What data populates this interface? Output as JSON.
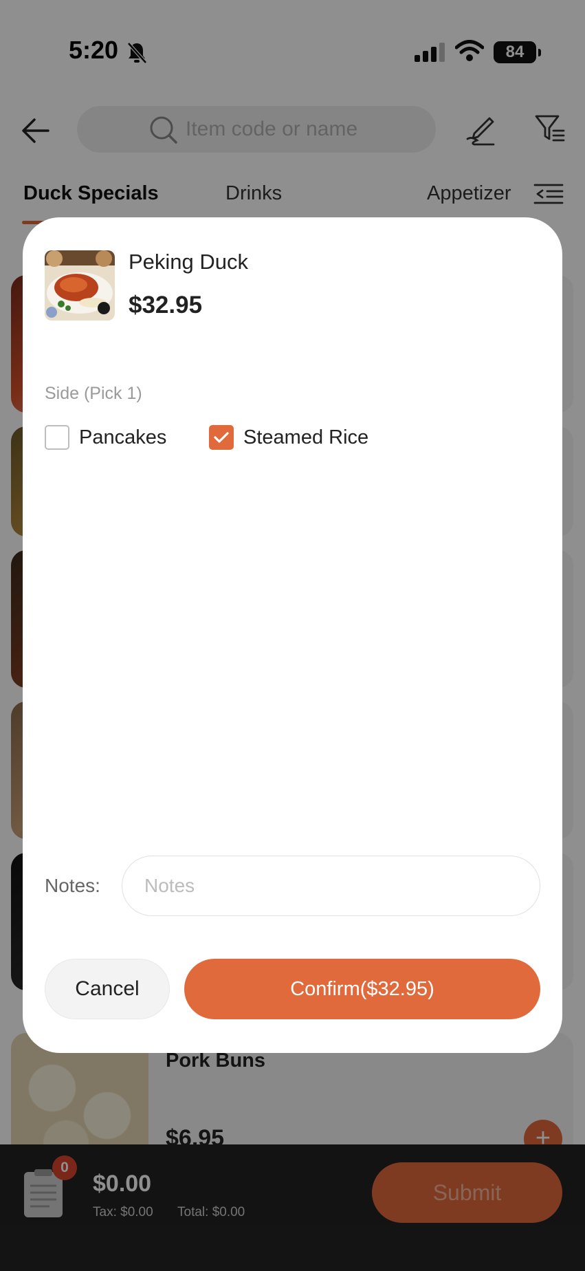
{
  "status_bar": {
    "time": "5:20",
    "battery": "84"
  },
  "search": {
    "placeholder": "Item code or name"
  },
  "tabs": [
    {
      "label": "Duck Specials",
      "active": true
    },
    {
      "label": "Drinks",
      "active": false
    },
    {
      "label": "Appetizer",
      "active": false
    }
  ],
  "menu_items": [
    {
      "name": "Pork Buns",
      "price": "$6.95"
    }
  ],
  "cart": {
    "count": "0",
    "total": "$0.00",
    "tax": "Tax: $0.00",
    "grand_total": "Total: $0.00",
    "submit_label": "Submit"
  },
  "modal": {
    "dish_name": "Peking Duck",
    "dish_price": "$32.95",
    "option_group": "Side (Pick 1)",
    "options": [
      {
        "label": "Pancakes",
        "checked": false
      },
      {
        "label": "Steamed Rice",
        "checked": true
      }
    ],
    "notes_label": "Notes:",
    "notes_placeholder": "Notes",
    "notes_value": "",
    "cancel_label": "Cancel",
    "confirm_label": "Confirm($32.95)"
  },
  "colors": {
    "accent": "#e06a3c",
    "overlay": "rgba(0,0,0,0.44)",
    "badge": "#d9442e",
    "bottom_bar": "#232323"
  },
  "icons": [
    "bell-slash-icon",
    "signal-icon",
    "wifi-icon",
    "back-arrow-icon",
    "search-icon",
    "pen-icon",
    "filter-icon",
    "category-menu-icon",
    "clipboard-icon",
    "plus-icon",
    "checkmark-icon"
  ]
}
